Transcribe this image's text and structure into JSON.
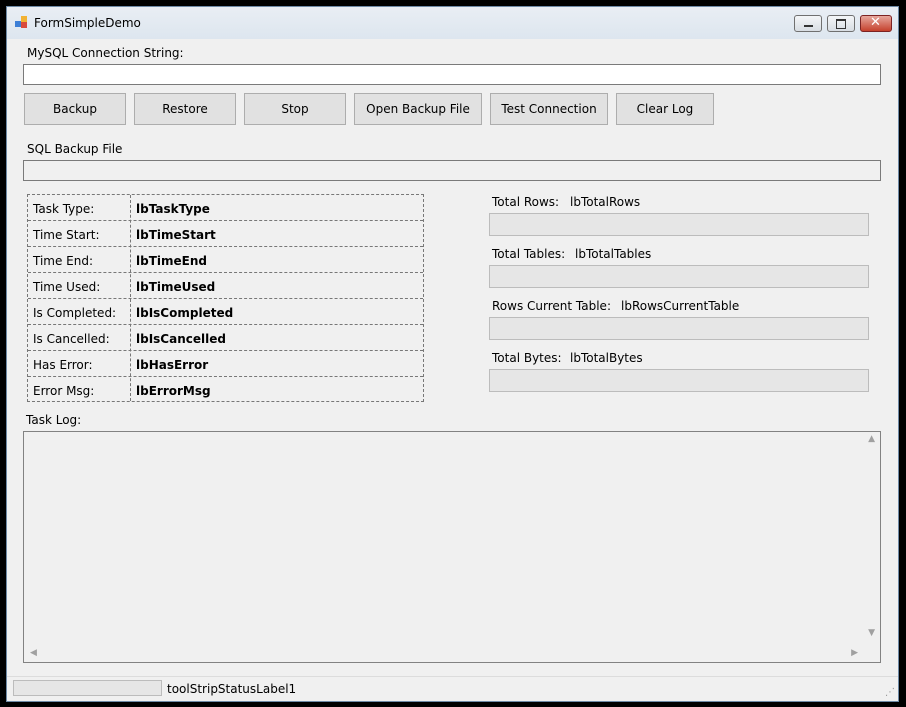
{
  "window": {
    "title": "FormSimpleDemo"
  },
  "connection": {
    "label": "MySQL Connection String:",
    "value": ""
  },
  "toolbar": {
    "backup": "Backup",
    "restore": "Restore",
    "stop": "Stop",
    "open_backup_file": "Open Backup File",
    "test_connection": "Test Connection",
    "clear_log": "Clear Log"
  },
  "backup_file": {
    "label": "SQL Backup File",
    "value": ""
  },
  "task_info": [
    {
      "key": "Task Type:",
      "value": "lbTaskType"
    },
    {
      "key": "Time Start:",
      "value": "lbTimeStart"
    },
    {
      "key": "Time End:",
      "value": "lbTimeEnd"
    },
    {
      "key": "Time Used:",
      "value": "lbTimeUsed"
    },
    {
      "key": "Is Completed:",
      "value": "lbIsCompleted"
    },
    {
      "key": "Is Cancelled:",
      "value": "lbIsCancelled"
    },
    {
      "key": "Has Error:",
      "value": "lbHasError"
    },
    {
      "key": "Error Msg:",
      "value": "lbErrorMsg"
    }
  ],
  "progress": [
    {
      "label": "Total Rows:",
      "value": "lbTotalRows",
      "fill": 0
    },
    {
      "label": "Total Tables:",
      "value": "lbTotalTables",
      "fill": 0
    },
    {
      "label": "Rows Current Table:",
      "value": "lbRowsCurrentTable",
      "fill": 0
    },
    {
      "label": "Total Bytes:",
      "value": "lbTotalBytes",
      "fill": 0
    }
  ],
  "log": {
    "label": "Task Log:",
    "content": ""
  },
  "status": {
    "label": "toolStripStatusLabel1",
    "progress": 0
  }
}
